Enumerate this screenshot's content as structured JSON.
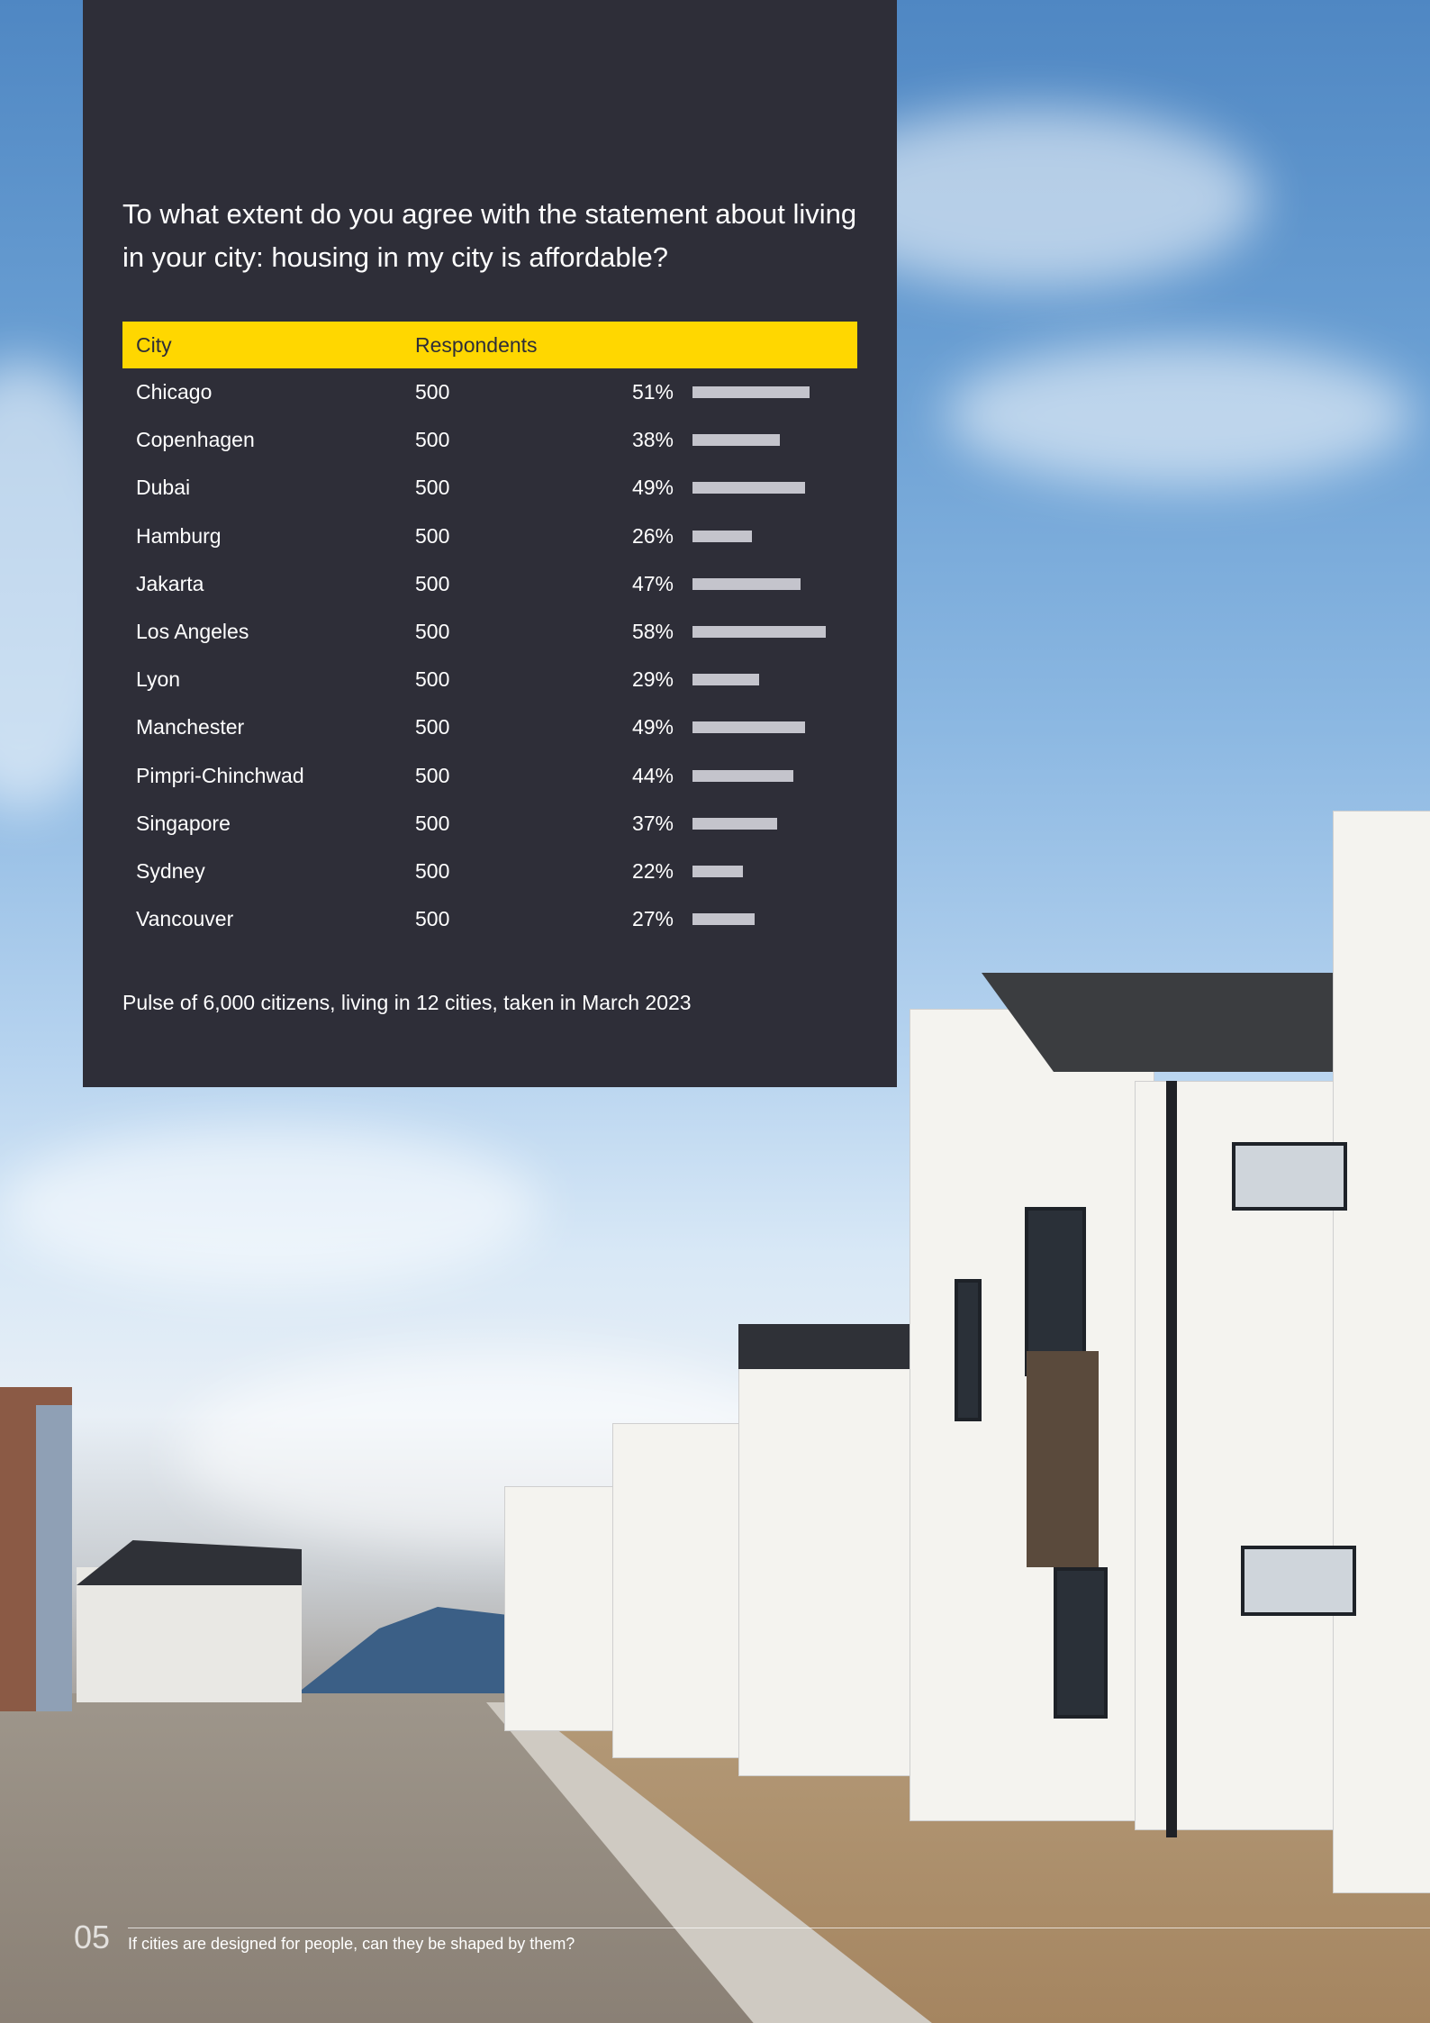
{
  "question": "To what extent do you agree with the statement about living in your city: housing in my city is affordable?",
  "table": {
    "headers": [
      "City",
      "Respondents"
    ],
    "rows": [
      {
        "city": "Chicago",
        "respondents": "500",
        "pct": "51%",
        "value": 51
      },
      {
        "city": "Copenhagen",
        "respondents": "500",
        "pct": "38%",
        "value": 38
      },
      {
        "city": "Dubai",
        "respondents": "500",
        "pct": "49%",
        "value": 49
      },
      {
        "city": "Hamburg",
        "respondents": "500",
        "pct": "26%",
        "value": 26
      },
      {
        "city": "Jakarta",
        "respondents": "500",
        "pct": "47%",
        "value": 47
      },
      {
        "city": "Los Angeles",
        "respondents": "500",
        "pct": "58%",
        "value": 58
      },
      {
        "city": "Lyon",
        "respondents": "500",
        "pct": "29%",
        "value": 29
      },
      {
        "city": "Manchester",
        "respondents": "500",
        "pct": "49%",
        "value": 49
      },
      {
        "city": "Pimpri-Chinchwad",
        "respondents": "500",
        "pct": "44%",
        "value": 44
      },
      {
        "city": "Singapore",
        "respondents": "500",
        "pct": "37%",
        "value": 37
      },
      {
        "city": "Sydney",
        "respondents": "500",
        "pct": "22%",
        "value": 22
      },
      {
        "city": "Vancouver",
        "respondents": "500",
        "pct": "27%",
        "value": 27
      }
    ]
  },
  "note": "Pulse of 6,000 citizens, living in 12 cities, taken in March 2023",
  "footer": {
    "page_number": "05",
    "text": "If cities are designed for people, can they be shaped by them?"
  },
  "colors": {
    "panel": "#2e2e38",
    "header_bar": "#ffd700",
    "bar": "#c4c4cc"
  }
}
